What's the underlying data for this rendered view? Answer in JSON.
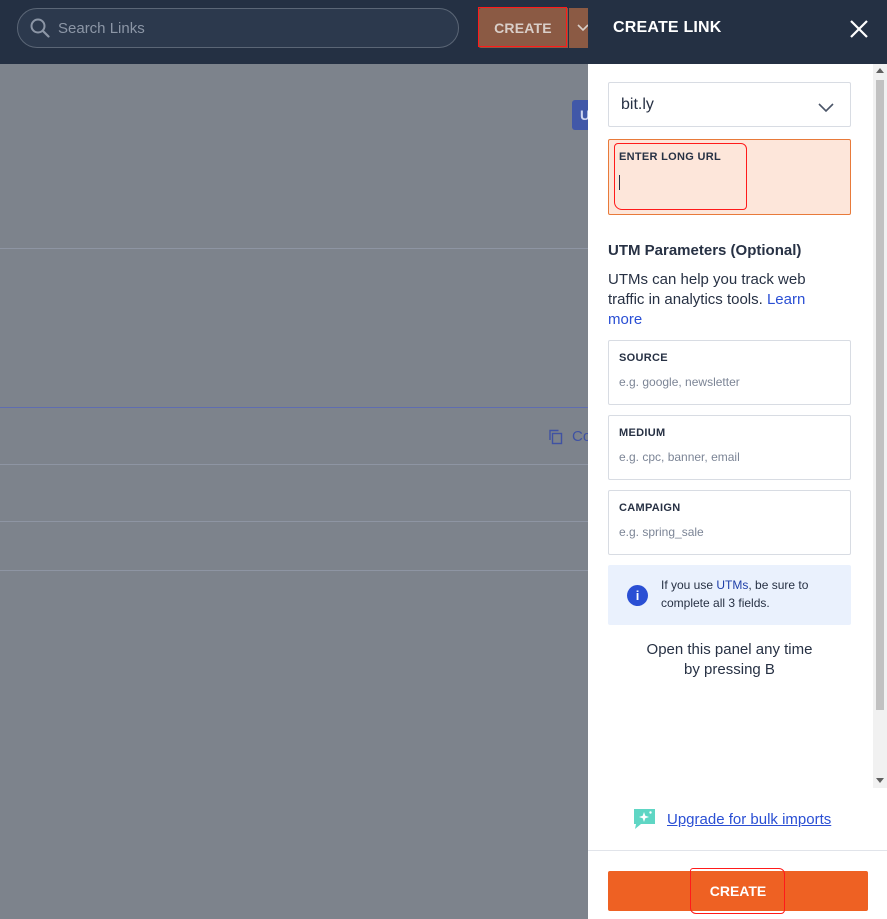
{
  "topbar": {
    "search_placeholder": "Search Links",
    "create_label": "CREATE"
  },
  "background": {
    "badge_text": "U",
    "copy_text": "Co"
  },
  "panel": {
    "title": "CREATE LINK",
    "domain": {
      "selected": "bit.ly"
    },
    "long_url": {
      "label": "ENTER LONG URL",
      "value": ""
    },
    "utm": {
      "title": "UTM Parameters (Optional)",
      "description": "UTMs can help you track web traffic in analytics tools.",
      "learn_more": "Learn more",
      "fields": [
        {
          "label": "SOURCE",
          "placeholder": "e.g. google, newsletter"
        },
        {
          "label": "MEDIUM",
          "placeholder": "e.g. cpc, banner, email"
        },
        {
          "label": "CAMPAIGN",
          "placeholder": "e.g. spring_sale"
        }
      ]
    },
    "info": {
      "prefix": "If you use ",
      "highlight": "UTMs",
      "suffix": ", be sure to complete all 3 fields."
    },
    "shortcut_line1": "Open this panel any time",
    "shortcut_line2": "by pressing B",
    "upgrade_link": "Upgrade for bulk imports",
    "create_button": "CREATE"
  },
  "colors": {
    "header_bg": "#243043",
    "accent_orange": "#ee6123",
    "link_blue": "#2a4fd4",
    "overlay_gray": "#7d838c",
    "annotation_red": "#ff1a1a"
  }
}
